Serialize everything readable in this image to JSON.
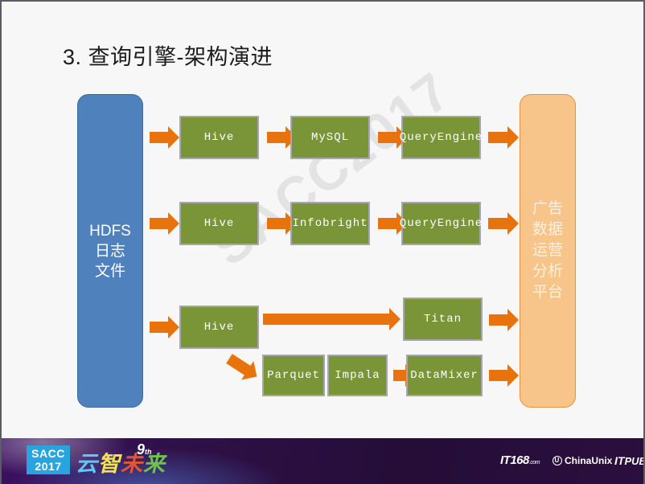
{
  "slide": {
    "title": "3. 查询引擎-架构演进",
    "watermark": "SACC2017",
    "background_color": "#f7f7f7"
  },
  "source": {
    "name": "HDFS-log-files",
    "lines": [
      "HDFS",
      "日志",
      "文件"
    ],
    "color": "#4f81bd"
  },
  "sink": {
    "name": "ad-data-platform",
    "lines": [
      "广告",
      "数据",
      "运营",
      "分析",
      "平台"
    ],
    "color": "#f7c489"
  },
  "palette": {
    "process_green": "#7a9538",
    "arrow_orange": "#e8730c",
    "box_border": "#a8a8a8",
    "footer_purple": "#2b0f3e",
    "badge_blue": "#29a4de"
  },
  "pipelines": [
    {
      "row": 1,
      "stages": [
        "Hive",
        "MySQL",
        "QueryEngine"
      ]
    },
    {
      "row": 2,
      "stages": [
        "Hive",
        "Infobright",
        "QueryEngine"
      ]
    },
    {
      "row": 3,
      "stages": [
        "Hive",
        "Titan"
      ]
    },
    {
      "row": 4,
      "stages": [
        "Parquet",
        "Impala",
        "DataMixer"
      ]
    }
  ],
  "boxes": {
    "r1_hive": "Hive",
    "r1_mysql": "MySQL",
    "r1_queryengine": "QueryEngine",
    "r2_hive": "Hive",
    "r2_infobright": "Infobright",
    "r2_queryengine": "QueryEngine",
    "r3_hive": "Hive",
    "r3_titan": "Titan",
    "r4_parquet": "Parquet",
    "r4_impala": "Impala",
    "r4_datamixer": "DataMixer"
  },
  "footer": {
    "badge_line1": "SACC",
    "badge_line2": "2017",
    "slogan_c1": "云",
    "slogan_c2": "智",
    "slogan_c3": "未",
    "slogan_c4": "来",
    "edition_number": "9",
    "edition_suffix": "th",
    "brand_it168": "IT168",
    "brand_it168_domain": ".com",
    "brand_chinaunix": "ChinaUnix",
    "brand_itpub_it": "IT",
    "brand_itpub_pub": "PUB"
  }
}
